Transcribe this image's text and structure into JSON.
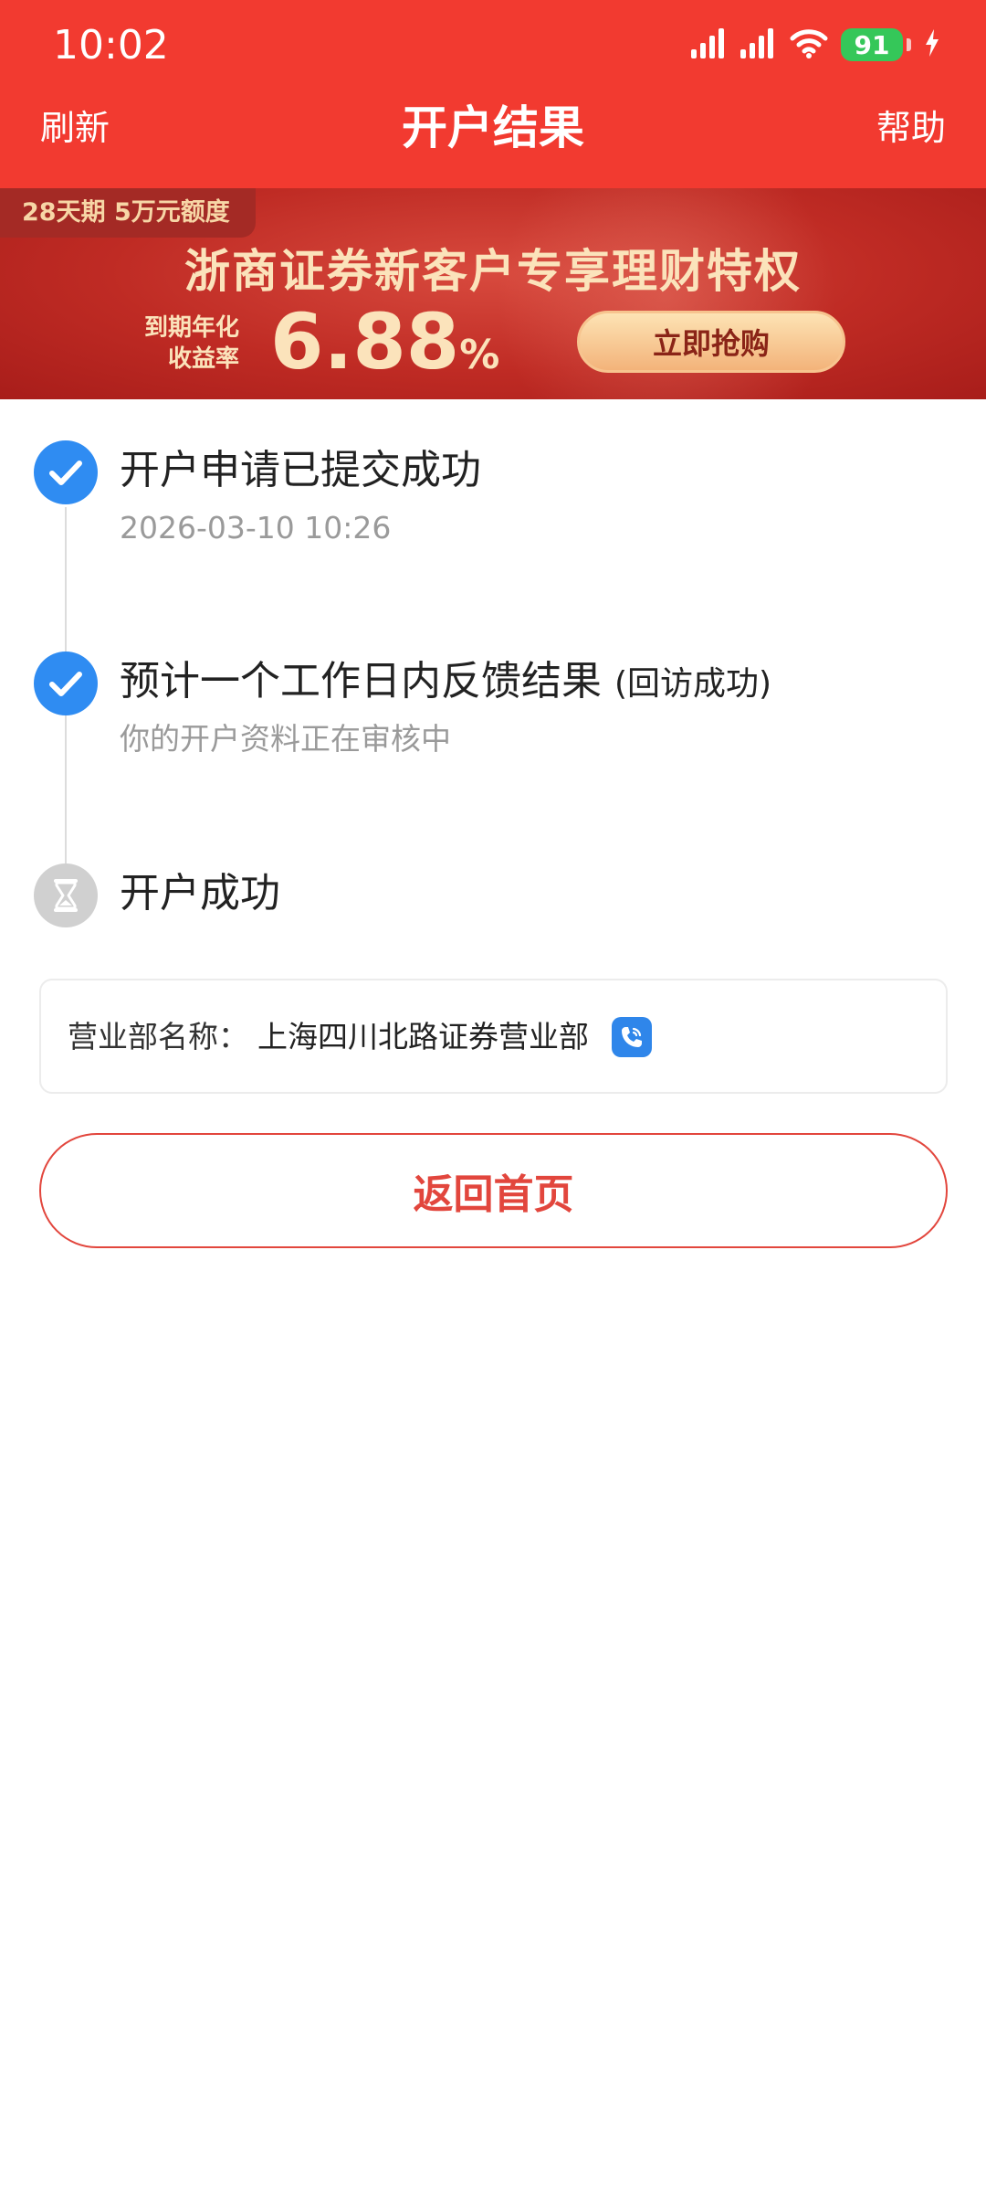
{
  "status_bar": {
    "time": "10:02",
    "battery": "91",
    "icons": [
      "signal-icon",
      "signal-icon",
      "wifi-icon",
      "battery-icon",
      "charging-icon"
    ]
  },
  "header": {
    "left_label": "刷新",
    "title": "开户结果",
    "right_label": "帮助"
  },
  "banner": {
    "tag": "28天期 5万元额度",
    "headline": "浙商证券新客户专享理财特权",
    "yield_label_line1": "到期年化",
    "yield_label_line2": "收益率",
    "rate": "6.88",
    "rate_suffix": "%",
    "cta": "立即抢购"
  },
  "timeline": {
    "steps": [
      {
        "title": "开户申请已提交成功",
        "subtitle": "2026-03-10 10:26",
        "status": "done",
        "icon": "check-icon"
      },
      {
        "title": "预计一个工作日内反馈结果",
        "title_suffix": "(回访成功)",
        "subtitle": "你的开户资料正在审核中",
        "status": "done",
        "icon": "check-icon"
      },
      {
        "title": "开户成功",
        "status": "pending",
        "icon": "hourglass-icon"
      }
    ]
  },
  "branch": {
    "label": "营业部名称：",
    "value": "上海四川北路证券营业部",
    "phone_icon": "phone-icon"
  },
  "actions": {
    "home_button": "返回首页"
  },
  "colors": {
    "brand_red": "#f23a30",
    "check_blue": "#2f8cf2",
    "pending_gray": "#d0d0d0",
    "button_red": "#e2463d"
  }
}
